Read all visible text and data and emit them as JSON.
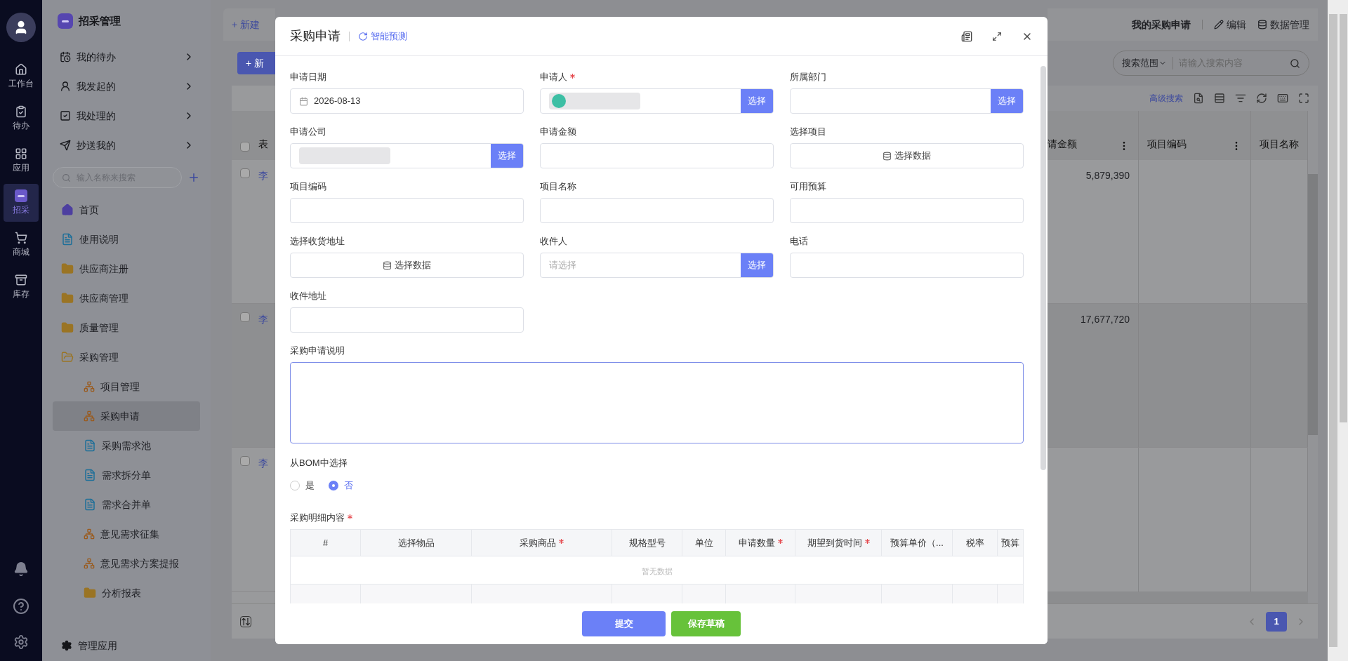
{
  "rail": {
    "items": [
      {
        "kind": "home",
        "label": "工作台",
        "selected": false
      },
      {
        "kind": "todo",
        "label": "待办",
        "selected": false
      },
      {
        "kind": "apps",
        "label": "应用",
        "selected": false
      },
      {
        "kind": "srm",
        "label": "招采",
        "selected": true
      },
      {
        "kind": "cart",
        "label": "商城",
        "selected": false
      },
      {
        "kind": "stock",
        "label": "库存",
        "selected": false
      }
    ]
  },
  "sidebar": {
    "title": "招采管理",
    "quick_items": [
      {
        "kind": "todo",
        "label": "我的待办"
      },
      {
        "kind": "started",
        "label": "我发起的"
      },
      {
        "kind": "handled",
        "label": "我处理的"
      },
      {
        "kind": "cc",
        "label": "抄送我的"
      }
    ],
    "search": {
      "placeholder": "输入名称来搜索"
    },
    "tree": [
      {
        "kind": "home",
        "label": "首页",
        "selected": false
      },
      {
        "kind": "doc",
        "label": "使用说明",
        "selected": false
      },
      {
        "kind": "folder",
        "label": "供应商注册",
        "selected": false
      },
      {
        "kind": "folder",
        "label": "供应商管理",
        "selected": false
      },
      {
        "kind": "folder",
        "label": "质量管理",
        "selected": false
      },
      {
        "kind": "folder",
        "label": "采购管理",
        "selected": false,
        "expanded": true,
        "children": [
          {
            "kind": "form",
            "label": "项目管理",
            "selected": false
          },
          {
            "kind": "form",
            "label": "采购申请",
            "selected": true
          },
          {
            "kind": "doc",
            "label": "采购需求池",
            "selected": false
          },
          {
            "kind": "doc",
            "label": "需求拆分单",
            "selected": false
          },
          {
            "kind": "doc",
            "label": "需求合并单",
            "selected": false
          },
          {
            "kind": "form",
            "label": "意见需求征集",
            "selected": false
          },
          {
            "kind": "form",
            "label": "意见需求方案提报",
            "selected": false
          },
          {
            "kind": "folder",
            "label": "分析报表",
            "selected": false
          }
        ]
      }
    ],
    "footer": "管理应用"
  },
  "background": {
    "tab": "+ 新建",
    "new_button": "+ 新",
    "column_1": "表",
    "header_checkbox": {
      "checked": false
    },
    "row_links": [
      {
        "label": "李",
        "checked": false
      },
      {
        "label": "李",
        "checked": false
      },
      {
        "label": "李",
        "checked": false
      }
    ],
    "header_links": {
      "title": "我的采购申请",
      "edit": "编辑",
      "data": "数据管理"
    },
    "search": {
      "scope": "搜索范围",
      "placeholder": "请输入搜索内容"
    },
    "advanced_search": "高级搜索",
    "columns": [
      "请金额",
      "项目编码",
      "项目名称"
    ],
    "rows": [
      [
        "5,879,390",
        "",
        ""
      ],
      [
        "17,677,720",
        "",
        ""
      ],
      [
        "",
        "",
        ""
      ]
    ],
    "pages": [
      {
        "label": "1",
        "selected": true
      }
    ]
  },
  "dialog": {
    "title": "采购申请",
    "smart_link": "智能预测",
    "fields": [
      {
        "kind": "date",
        "label": "申请日期",
        "required": false,
        "value": "2026-08-13"
      },
      {
        "kind": "redacted-picker",
        "label": "申请人",
        "required": true,
        "button": "选择"
      },
      {
        "kind": "picker",
        "label": "所属部门",
        "required": false,
        "button": "选择"
      },
      {
        "kind": "redacted-picker",
        "label": "申请公司",
        "required": false,
        "button": "选择"
      },
      {
        "kind": "readonly",
        "label": "申请金额",
        "required": false
      },
      {
        "kind": "data-button",
        "label": "选择项目",
        "required": false,
        "button": "选择数据"
      },
      {
        "kind": "text",
        "label": "项目编码",
        "required": false
      },
      {
        "kind": "text",
        "label": "项目名称",
        "required": false
      },
      {
        "kind": "text",
        "label": "可用预算",
        "required": false
      },
      {
        "kind": "data-button",
        "label": "选择收货地址",
        "required": false,
        "button": "选择数据"
      },
      {
        "kind": "picker",
        "label": "收件人",
        "required": false,
        "placeholder": "请选择",
        "button": "选择"
      },
      {
        "kind": "text",
        "label": "电话",
        "required": false
      },
      {
        "kind": "text",
        "label": "收件地址",
        "required": false
      }
    ],
    "description": {
      "label": "采购申请说明"
    },
    "bom": {
      "label": "从BOM中选择",
      "options": [
        {
          "label": "是",
          "selected": false
        },
        {
          "label": "否",
          "selected": true
        }
      ]
    },
    "details": {
      "label": "采购明细内容",
      "required": true,
      "columns": [
        {
          "label": "#",
          "required": false
        },
        {
          "label": "选择物品",
          "required": false
        },
        {
          "label": "采购商品",
          "required": true
        },
        {
          "label": "规格型号",
          "required": false
        },
        {
          "label": "单位",
          "required": false
        },
        {
          "label": "申请数量",
          "required": true
        },
        {
          "label": "期望到货时间",
          "required": true
        },
        {
          "label": "预算单价（...",
          "required": false
        },
        {
          "label": "税率",
          "required": false
        },
        {
          "label": "预算",
          "required": false
        }
      ],
      "empty_text": "暂无数据"
    },
    "buttons": [
      {
        "kind": "primary",
        "label": "提交"
      },
      {
        "kind": "success",
        "label": "保存草稿"
      }
    ]
  }
}
